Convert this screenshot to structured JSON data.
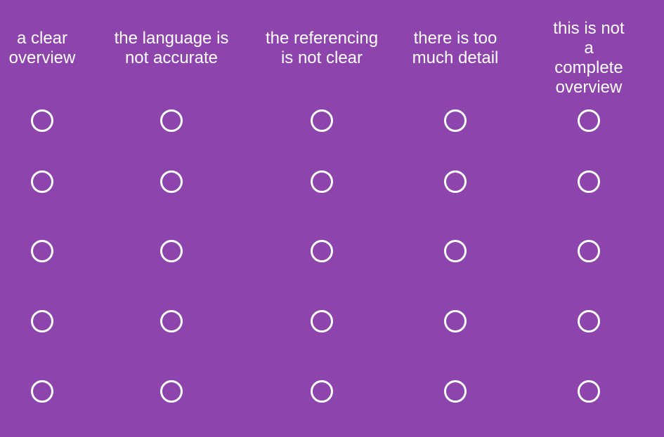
{
  "colors": {
    "background": "#8e44ad",
    "text": "#ffffff",
    "radio_border": "#ffffff"
  },
  "columns": [
    {
      "label": "a clear\noverview"
    },
    {
      "label": "the language is\nnot accurate"
    },
    {
      "label": "the referencing\nis not clear"
    },
    {
      "label": "there is too\nmuch detail"
    },
    {
      "label": "this is not a\ncomplete\noverview"
    }
  ],
  "rows": 5,
  "selected": []
}
